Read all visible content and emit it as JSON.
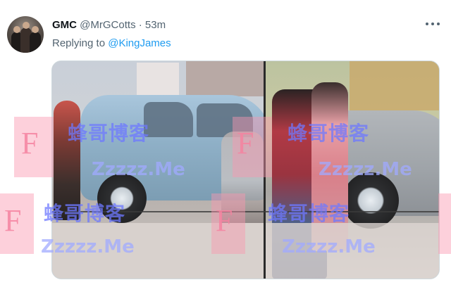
{
  "tweet": {
    "name": "GMC",
    "handle": "@MrGCotts",
    "separator": "·",
    "time": "53m",
    "replying_prefix": "Replying to",
    "replying_to": "@KingJames"
  },
  "watermark": {
    "cn": "蜂哥博客",
    "url": "Zzzzz.Me",
    "f": "F"
  },
  "icons": {
    "menu": "more-horizontal-icon"
  }
}
